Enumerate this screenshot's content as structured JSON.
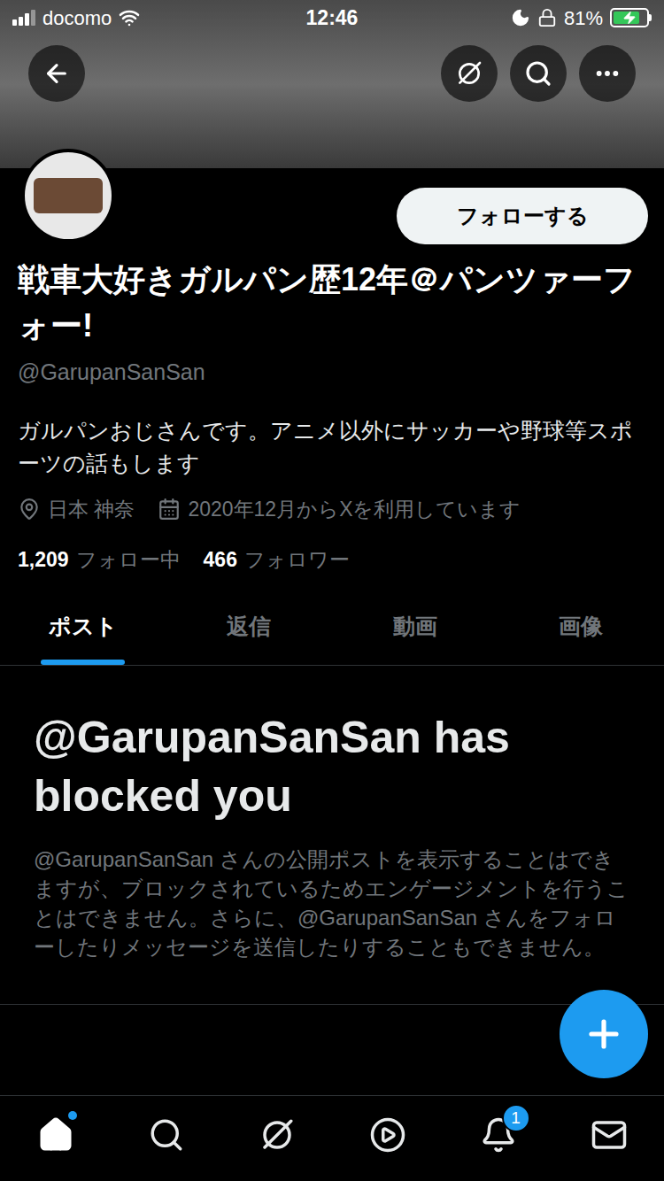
{
  "status_bar": {
    "carrier": "docomo",
    "time": "12:46",
    "battery": "81%",
    "battery_level": 0.81,
    "charging": true
  },
  "header_buttons": [
    {
      "kind": "back"
    },
    {
      "kind": "grok"
    },
    {
      "kind": "search"
    },
    {
      "kind": "more"
    }
  ],
  "profile": {
    "follow_button": "フォローする",
    "name": "戦車大好きガルパン歴12年＠パンツァーフォー!",
    "handle": "@GarupanSanSan",
    "bio": "ガルパンおじさんです。アニメ以外にサッカーや野球等スポーツの話もします",
    "location": "日本 神奈",
    "joined": "2020年12月からXを利用しています",
    "following_count": "1,209",
    "following_label": "フォロー中",
    "followers_count": "466",
    "followers_label": "フォロワー"
  },
  "tabs": [
    {
      "label": "ポスト",
      "selected": true
    },
    {
      "label": "返信",
      "selected": false
    },
    {
      "label": "動画",
      "selected": false
    },
    {
      "label": "画像",
      "selected": false
    }
  ],
  "blocked_notice": {
    "title": "@GarupanSanSan has blocked you",
    "body": "@GarupanSanSan さんの公開ポストを表示することはできますが、ブロックされているためエンゲージメントを行うことはできません。さらに、@GarupanSanSan さんをフォローしたりメッセージを送信したりすることもできません。"
  },
  "bottom_nav": [
    {
      "kind": "home",
      "selected": true,
      "dot": true,
      "badge": ""
    },
    {
      "kind": "search",
      "selected": false,
      "dot": false,
      "badge": ""
    },
    {
      "kind": "grok",
      "selected": false,
      "dot": false,
      "badge": ""
    },
    {
      "kind": "video",
      "selected": false,
      "dot": false,
      "badge": ""
    },
    {
      "kind": "notifications",
      "selected": false,
      "dot": false,
      "badge": "1"
    },
    {
      "kind": "messages",
      "selected": false,
      "dot": false,
      "badge": ""
    }
  ]
}
